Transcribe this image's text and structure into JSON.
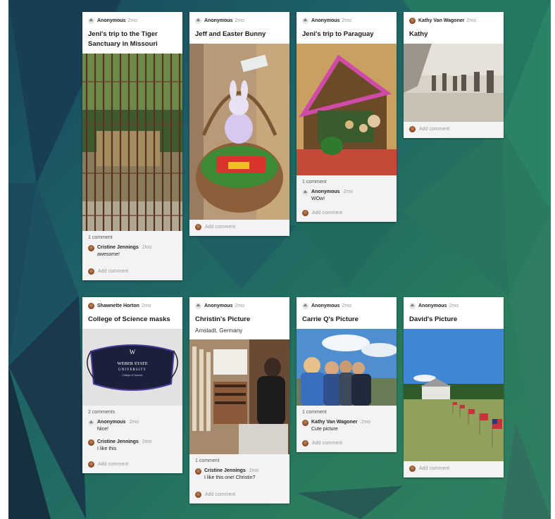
{
  "cards": [
    {
      "author": "Anonymous",
      "time": "2mo",
      "avatar": "anon-icon",
      "title": "Jeni's trip to the Tiger Sanctuary in Missouri",
      "comment_count": "1 comment",
      "comments": [
        {
          "author": "Cristine Jennings",
          "time": "2mo",
          "text": "awesome!"
        }
      ],
      "add_comment": "Add comment"
    },
    {
      "author": "Anonymous",
      "time": "2mo",
      "avatar": "anon-icon",
      "title": "Jeff and Easter Bunny",
      "add_comment": "Add comment"
    },
    {
      "author": "Anonymous",
      "time": "2mo",
      "avatar": "anon-icon",
      "title": "Jeni's trip to Paraguay",
      "comment_count": "1 comment",
      "comments": [
        {
          "author": "Anonymous",
          "time": "2mo",
          "text": "WOw!"
        }
      ],
      "add_comment": "Add comment"
    },
    {
      "author": "Kathy Van Wagoner",
      "time": "2mo",
      "avatar": "user-photo",
      "title": "Kathy",
      "add_comment": "Add comment"
    },
    {
      "author": "Shawnette Horton",
      "time": "2mo",
      "avatar": "user-photo",
      "title": "College of Science masks",
      "mask_text": {
        "line1": "WEBER STATE",
        "line2": "UNIVERSITY",
        "line3": "College of Science"
      },
      "comment_count": "2 comments",
      "comments": [
        {
          "author": "Anonymous",
          "time": "2mo",
          "text": "Nice!"
        },
        {
          "author": "Cristine Jennings",
          "time": "2mo",
          "text": "I like this"
        }
      ],
      "add_comment": "Add comment"
    },
    {
      "author": "Anonymous",
      "time": "2mo",
      "avatar": "anon-icon",
      "title": "Christin's Picture",
      "subtitle": "Arnstadt, Germany",
      "comment_count": "1 comment",
      "comments": [
        {
          "author": "Cristine Jennings",
          "time": "2mo",
          "text": "I like this one! Christin?"
        }
      ],
      "add_comment": "Add comment"
    },
    {
      "author": "Anonymous",
      "time": "2mo",
      "avatar": "anon-icon",
      "title": "Carrie Q's Picture",
      "comment_count": "1 comment",
      "comments": [
        {
          "author": "Kathy Van Wagoner",
          "time": "2mo",
          "text": "Cute picture"
        }
      ],
      "add_comment": "Add comment"
    },
    {
      "author": "Anonymous",
      "time": "2mo",
      "avatar": "anon-icon",
      "title": "David's Picture",
      "add_comment": "Add comment"
    }
  ]
}
